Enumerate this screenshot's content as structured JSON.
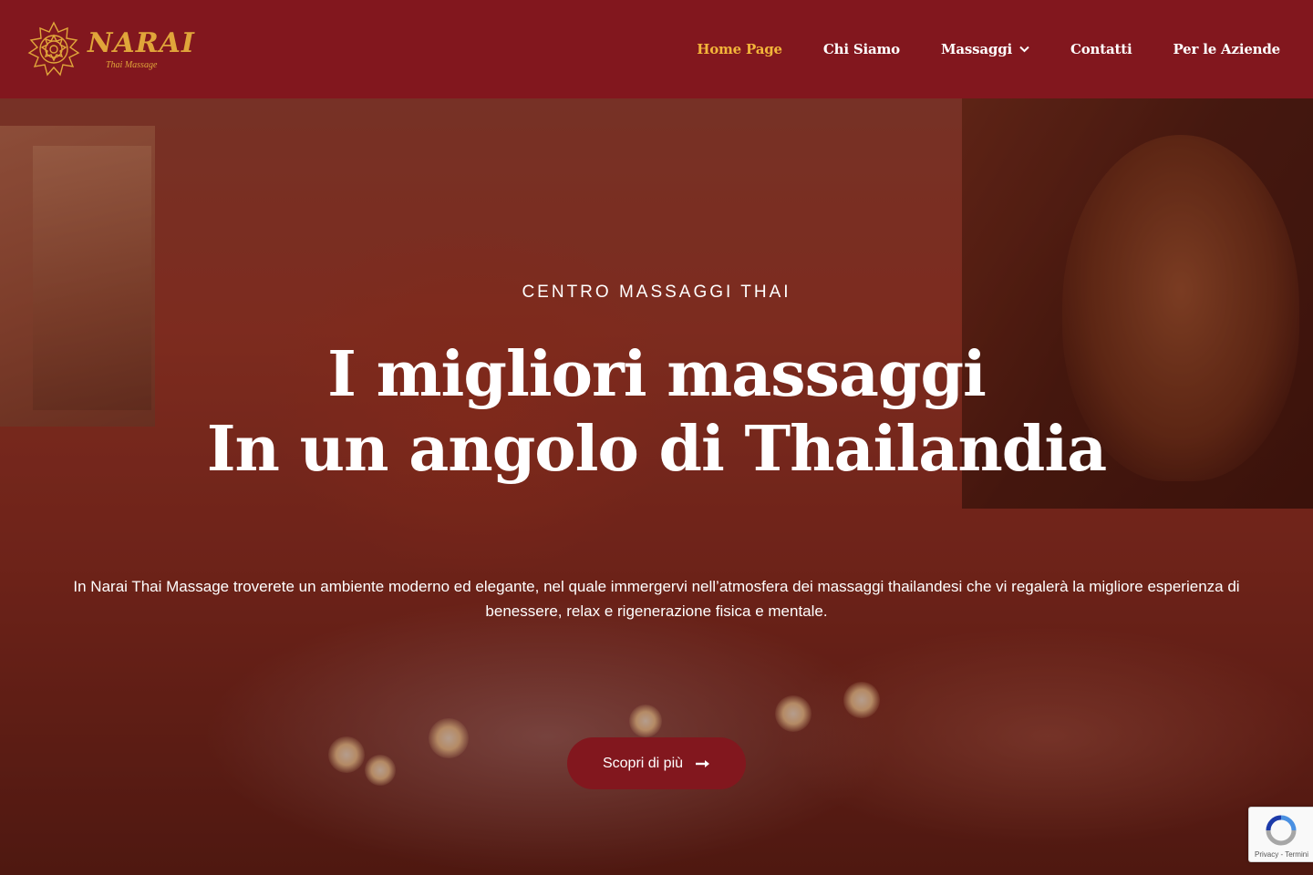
{
  "brand": {
    "name": "NARAI",
    "tagline": "Thai Massage",
    "accent_color": "#e0a53a",
    "header_color": "#82171e"
  },
  "nav": {
    "items": [
      {
        "label": "Home Page",
        "active": true
      },
      {
        "label": "Chi Siamo",
        "active": false
      },
      {
        "label": "Massaggi",
        "active": false,
        "has_dropdown": true
      },
      {
        "label": "Contatti",
        "active": false
      },
      {
        "label": "Per le Aziende",
        "active": false
      }
    ],
    "active_color": "#f2b53a"
  },
  "hero": {
    "eyebrow": "CENTRO MASSAGGI THAI",
    "headline_line1": "I migliori massaggi",
    "headline_line2": "In un angolo di Thailandia",
    "description_line1": "In Narai Thai Massage troverete un ambiente moderno ed elegante, nel quale immergervi nell’atmosfera dei massaggi thailandesi che vi regalerà la migliore esperienza di",
    "description_line2": "benessere, relax e rigenerazione fisica e mentale.",
    "cta_label": "Scopri di più",
    "cta_icon": "arrow-right-icon"
  },
  "recaptcha": {
    "links": "Privacy - Termini"
  }
}
